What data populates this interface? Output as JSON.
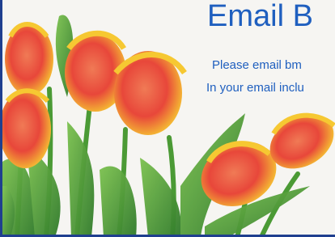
{
  "banner": {
    "title": "Email B",
    "line1": "Please email bm",
    "line2": "In your email inclu"
  },
  "image": {
    "subject": "tulip-bouquet-photo",
    "colors": {
      "petal_red": "#e8473a",
      "petal_yellow": "#f6c832",
      "stem_green": "#5aa03a",
      "border": "#1f3f8f",
      "text": "#1f5fbf"
    }
  }
}
